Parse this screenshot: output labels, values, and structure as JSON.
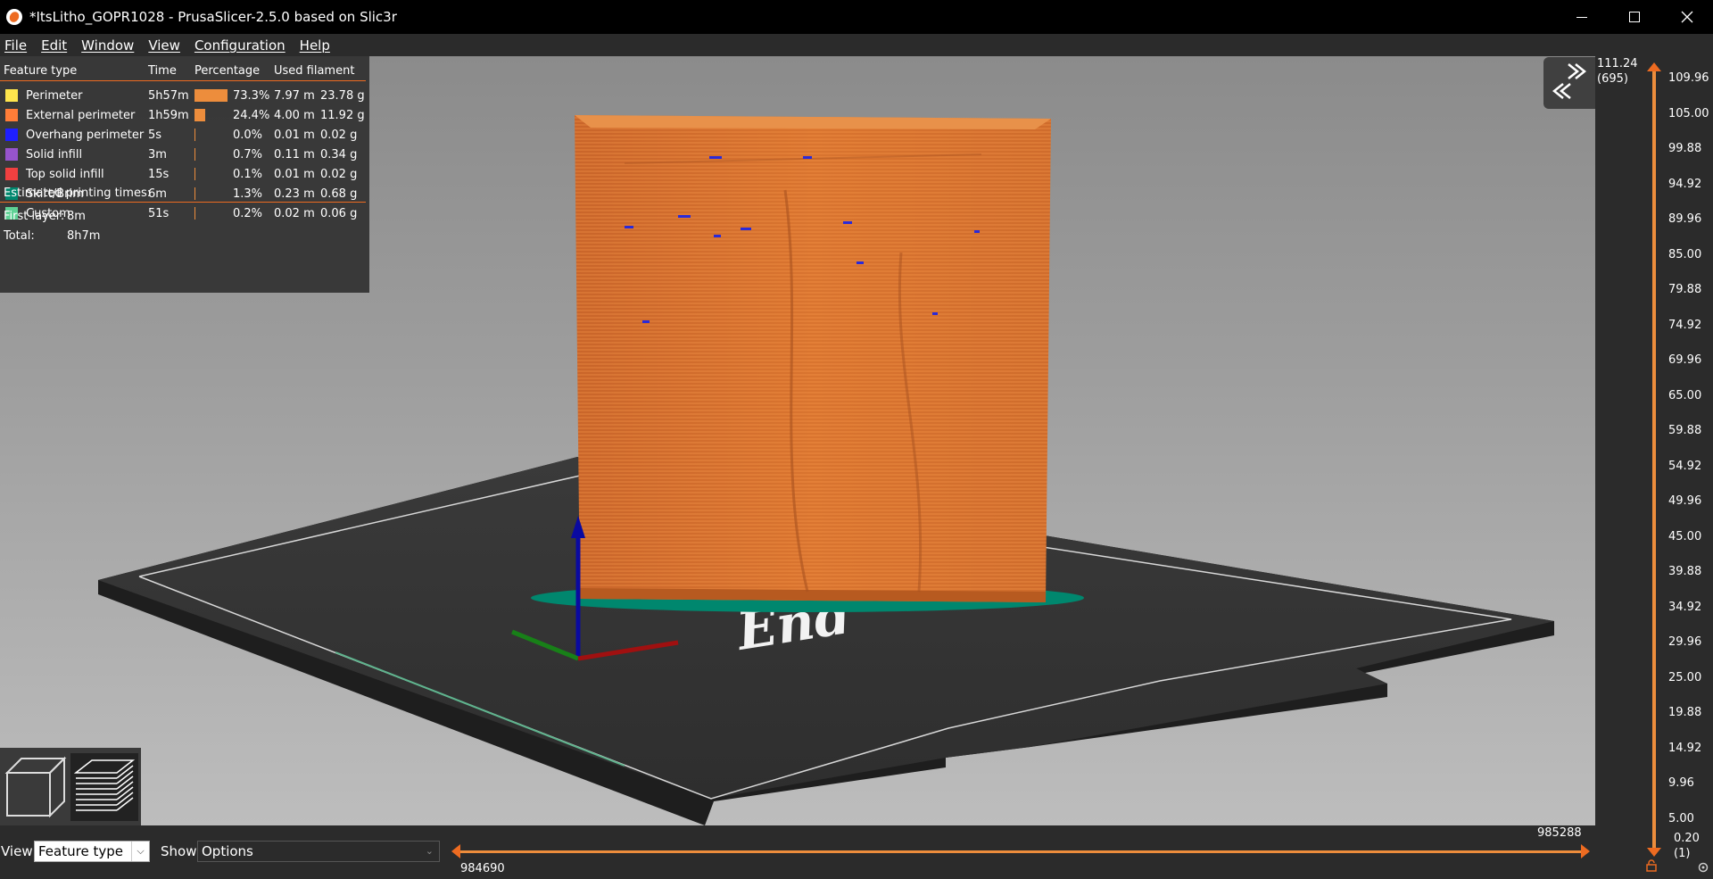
{
  "window": {
    "title": "*ItsLitho_GOPR1028 - PrusaSlicer-2.5.0 based on Slic3r",
    "minimize_icon": "minimize-icon",
    "maximize_icon": "maximize-icon",
    "close_icon": "close-icon"
  },
  "menu": [
    "File",
    "Edit",
    "Window",
    "View",
    "Configuration",
    "Help"
  ],
  "legend": {
    "headers": {
      "feature_type": "Feature type",
      "time": "Time",
      "percentage": "Percentage",
      "used_filament": "Used filament"
    },
    "rows": [
      {
        "name": "Perimeter",
        "time": "5h57m",
        "percent": "73.3%",
        "percent_value": 73.3,
        "length": "7.97 m",
        "weight": "23.78 g",
        "color": "#ffe64d"
      },
      {
        "name": "External perimeter",
        "time": "1h59m",
        "percent": "24.4%",
        "percent_value": 24.4,
        "length": "4.00 m",
        "weight": "11.92 g",
        "color": "#ff7d38"
      },
      {
        "name": "Overhang perimeter",
        "time": "5s",
        "percent": "0.0%",
        "percent_value": 0.0,
        "length": "0.01 m",
        "weight": "0.02 g",
        "color": "#1f1fff"
      },
      {
        "name": "Solid infill",
        "time": "3m",
        "percent": "0.7%",
        "percent_value": 0.7,
        "length": "0.11 m",
        "weight": "0.34 g",
        "color": "#9654cc"
      },
      {
        "name": "Top solid infill",
        "time": "15s",
        "percent": "0.1%",
        "percent_value": 0.1,
        "length": "0.01 m",
        "weight": "0.02 g",
        "color": "#f04040"
      },
      {
        "name": "Skirt/Brim",
        "time": "6m",
        "percent": "1.3%",
        "percent_value": 1.3,
        "length": "0.23 m",
        "weight": "0.68 g",
        "color": "#00876e"
      },
      {
        "name": "Custom",
        "time": "51s",
        "percent": "0.2%",
        "percent_value": 0.2,
        "length": "0.02 m",
        "weight": "0.06 g",
        "color": "#5ed194"
      }
    ],
    "estimated_title": "Estimated printing times:",
    "first_layer_label": "First layer:",
    "first_layer_value": "8m",
    "total_label": "Total:",
    "total_value": "8h7m"
  },
  "scene": {
    "bed_logo_text": "End",
    "model_color": "#d9742f",
    "brim_color": "#00876e"
  },
  "vertical_slider": {
    "top_value": "111.24",
    "top_layer": "(695)",
    "ticks": [
      "109.96",
      "105.00",
      "99.88",
      "94.92",
      "89.96",
      "85.00",
      "79.88",
      "74.92",
      "69.96",
      "65.00",
      "59.88",
      "54.92",
      "49.96",
      "45.00",
      "39.88",
      "34.92",
      "29.96",
      "25.00",
      "19.88",
      "14.92",
      "9.96",
      "5.00"
    ],
    "bottom_value": "0.20",
    "bottom_layer": "(1)"
  },
  "bottom_bar": {
    "view_label": "View",
    "view_value": "Feature type",
    "show_label": "Show",
    "show_value": "Options",
    "slider_left_value": "984690",
    "slider_right_value": "985288"
  },
  "icons": {
    "collapse": "collapse-sidebar-icon",
    "view_3d": "cube-icon",
    "view_preview": "layers-icon",
    "lock": "lock-icon",
    "settings": "cog-icon"
  },
  "accent_color": "#ed6b21"
}
